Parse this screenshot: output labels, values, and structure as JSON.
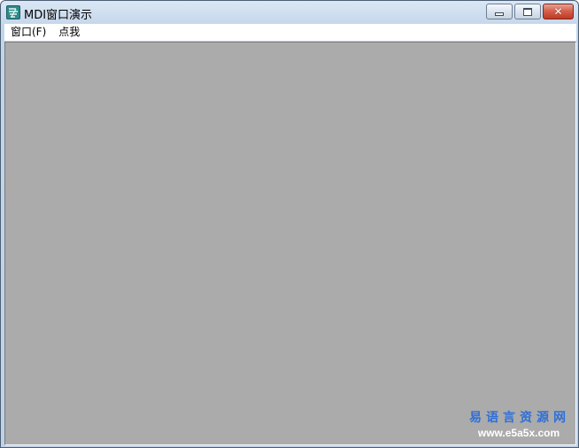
{
  "window": {
    "title": "MDI窗口演示",
    "icon": "app-icon"
  },
  "caption_buttons": {
    "minimize_icon": "minimize-icon",
    "maximize_icon": "maximize-icon",
    "close_icon": "close-icon"
  },
  "menu": {
    "items": [
      {
        "label": "窗口(F)"
      },
      {
        "label": "点我"
      }
    ]
  },
  "mdi_client": {
    "background": "#ababab"
  },
  "watermark": {
    "title": "易语言资源网",
    "url": "www.e5a5x.com"
  },
  "colors": {
    "title_gradient_top": "#dbe7f4",
    "title_gradient_bottom": "#c3d5ea",
    "close_button": "#c1391f",
    "watermark_title": "#2f6fd8"
  }
}
